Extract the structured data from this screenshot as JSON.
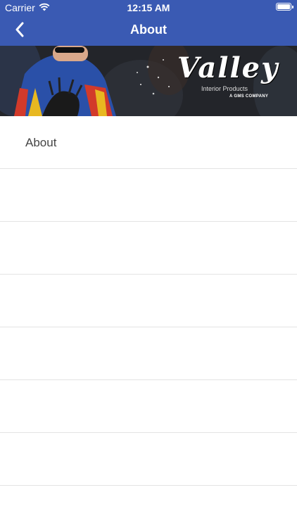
{
  "status_bar": {
    "carrier": "Carrier",
    "time": "12:15 AM",
    "icons": [
      "wifi-icon",
      "battery-icon"
    ]
  },
  "nav": {
    "title": "About",
    "back_icon": "chevron-left-icon"
  },
  "banner": {
    "logo_word": "Valley",
    "logo_line1": "Interior Products",
    "logo_line2": "A GMS COMPANY"
  },
  "list": {
    "items": [
      {
        "label": "About"
      },
      {
        "label": ""
      },
      {
        "label": ""
      },
      {
        "label": ""
      },
      {
        "label": ""
      },
      {
        "label": ""
      },
      {
        "label": ""
      }
    ]
  },
  "colors": {
    "header_bg": "#3a5ab3",
    "divider": "#e3e3e3",
    "text": "#444444"
  }
}
